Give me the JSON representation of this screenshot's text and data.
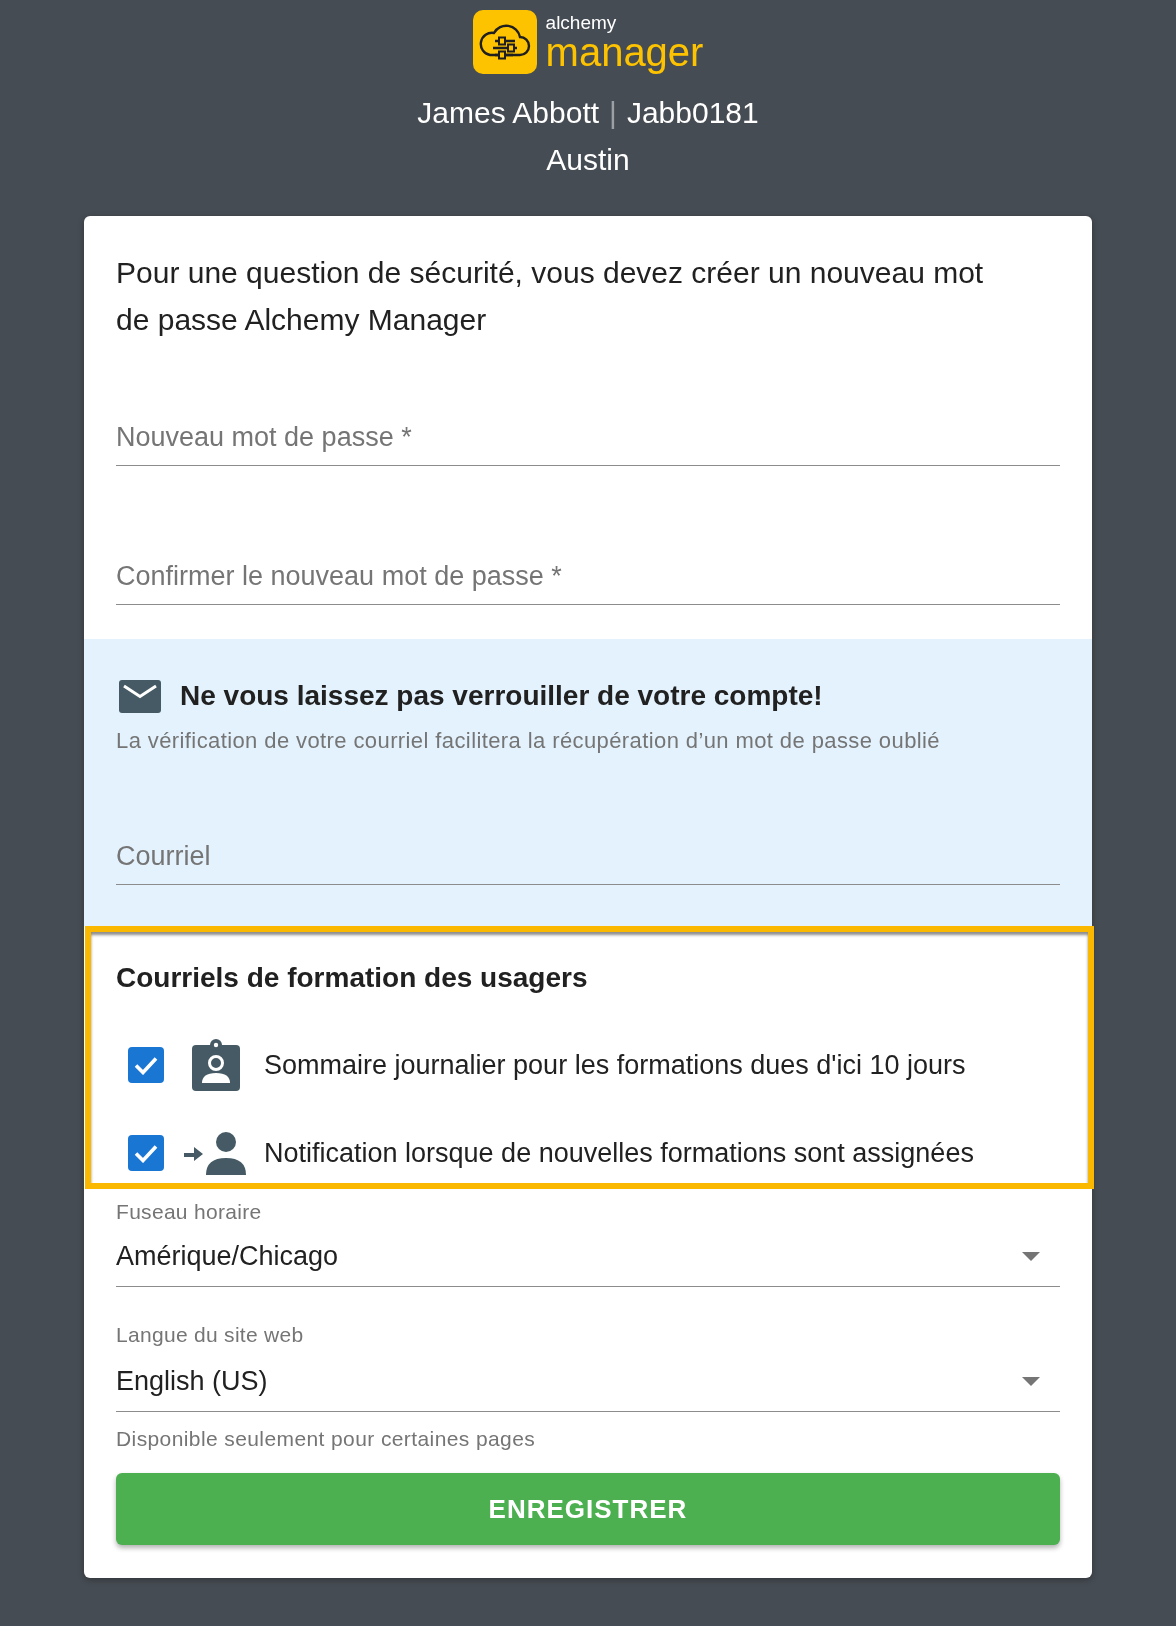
{
  "header": {
    "logo": {
      "top_text": "alchemy",
      "main_text": "manager"
    },
    "user_name": "James Abbott",
    "separator": "|",
    "user_id": "Jabb0181",
    "location": "Austin"
  },
  "intro": "Pour une question de sécurité, vous devez créer un nouveau mot de passe Alchemy Manager",
  "password_fields": [
    {
      "placeholder": "Nouveau mot de passe *"
    },
    {
      "placeholder": "Confirmer le nouveau mot de passe *"
    }
  ],
  "email_verification": {
    "title": "Ne vous laissez pas verrouiller de votre compte!",
    "subtitle": "La vérification de votre courriel facilitera la récupération d’un mot de passe oublié",
    "email_field": {
      "placeholder": "Courriel"
    }
  },
  "training_emails": {
    "highlighted": true,
    "title": "Courriels de formation des usagers",
    "options": [
      {
        "label": "Sommaire journalier pour les formations dues d'ici 10 jours",
        "checked": true
      },
      {
        "label": "Notification lorsque de nouvelles formations sont assignées",
        "checked": true
      }
    ]
  },
  "timezone": {
    "label": "Fuseau horaire",
    "value": "Amérique/Chicago"
  },
  "language": {
    "label": "Langue du site web",
    "value": "English (US)",
    "helper": "Disponible seulement pour certaines pages"
  },
  "save_button": {
    "label": "ENREGISTRER"
  }
}
